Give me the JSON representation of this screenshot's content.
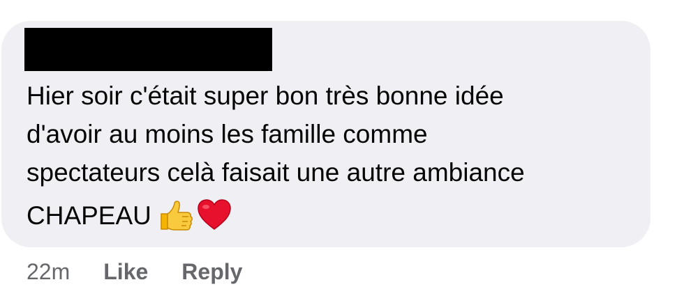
{
  "comment": {
    "author_redacted": true,
    "lines": [
      "Hier soir c'était super bon très bonne idée",
      "d'avoir au moins les famille comme",
      "spectateurs celà faisait une autre ambiance"
    ],
    "last_line": "CHAPEAU",
    "emojis": [
      "thumbs-up-icon",
      "red-heart-icon"
    ]
  },
  "meta": {
    "time": "22m",
    "like_label": "Like",
    "reply_label": "Reply"
  },
  "colors": {
    "bubble": "#efeff4",
    "text": "#050505",
    "meta": "#65676b"
  }
}
